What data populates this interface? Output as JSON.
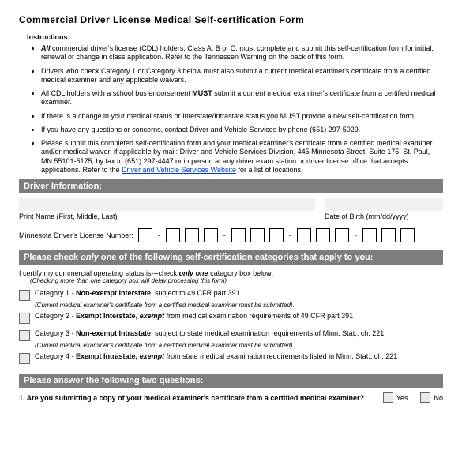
{
  "title": "Commercial Driver License Medical Self-certification Form",
  "instructions_head": "Instructions:",
  "instr": {
    "i1a": "All",
    "i1b": " commercial driver's license (CDL) holders, Class A, B or C, must complete and submit this self-certification form for initial, renewal or change in class application. Refer to the Tennessen Warning on the back of this form.",
    "i2": "Drivers who check Category 1 or Category 3 below must also submit a current medical examiner's certificate from a certified medical examiner and any applicable waivers.",
    "i3a": "All CDL holders with a school bus endorsement ",
    "i3b": "MUST",
    "i3c": " submit a current medical examiner's certificate from a certified medical examiner.",
    "i4": "If there is a change in your medical status or Interstate/Intrastate status you MUST provide a new self-certification form.",
    "i5": "If you have any questions or concerns, contact Driver and Vehicle Services by phone (651) 297-5029.",
    "i6a": "Please submit this completed self-certification form and your medical examiner's certificate from a certified medical examiner and/or medical waiver, if applicable by mail: Driver and Vehicle Services Division, 445 Minnesota Street, Suite 175, St. Paul, MN 55101-5175, by fax to (651) 297-4447 or in person at any driver exam station or driver license office that accepts applications. Refer to the ",
    "i6link": "Driver and Vehicle Services Website",
    "i6b": " for a list of locations."
  },
  "bars": {
    "driver": "Driver Information:",
    "categories": "Please check only one of the following self-certification categories that apply to you:",
    "questions": "Please answer the following two questions:"
  },
  "labels": {
    "print_name": "Print Name (First, Middle, Last)",
    "dob": "Date of Birth (mm/dd/yyyy)",
    "license": "Minnesota Driver's License Number:"
  },
  "cert": {
    "lead_a": "I certify my commercial operating status is---check ",
    "lead_b": "only one",
    "lead_c": " category box below:",
    "sub": "(Checking more than one category box will delay processing this form)",
    "c1a": "Category 1 - ",
    "c1b": "Non-exempt Interstate",
    "c1c": ", subject to 49 CFR part 391",
    "c1s": "(Current medical examiner's certificate from a certified medical examiner must be submitted).",
    "c2a": "Category 2 - ",
    "c2b": "Exempt Interstate, ",
    "c2bi": "exempt",
    "c2c": " from medical examination requirements of 49 CFR part 391",
    "c3a": "Category 3 - ",
    "c3b": "Non-exempt Intrastate",
    "c3c": ", subject to state medical examination requirements of Minn. Stat., ch. 221",
    "c3s": "(Current medical examiner's certificate from a certified medical examiner must be submitted).",
    "c4a": "Category 4 - ",
    "c4b": "Exempt Intrastate, ",
    "c4bi": "exempt",
    "c4c": " from state medical examination requirements listed in Minn. Stat., ch. 221"
  },
  "q": {
    "q1": "1. Are you submitting a copy of your medical examiner's certificate from a certified medical examiner?",
    "yes": "Yes",
    "no": "No"
  }
}
